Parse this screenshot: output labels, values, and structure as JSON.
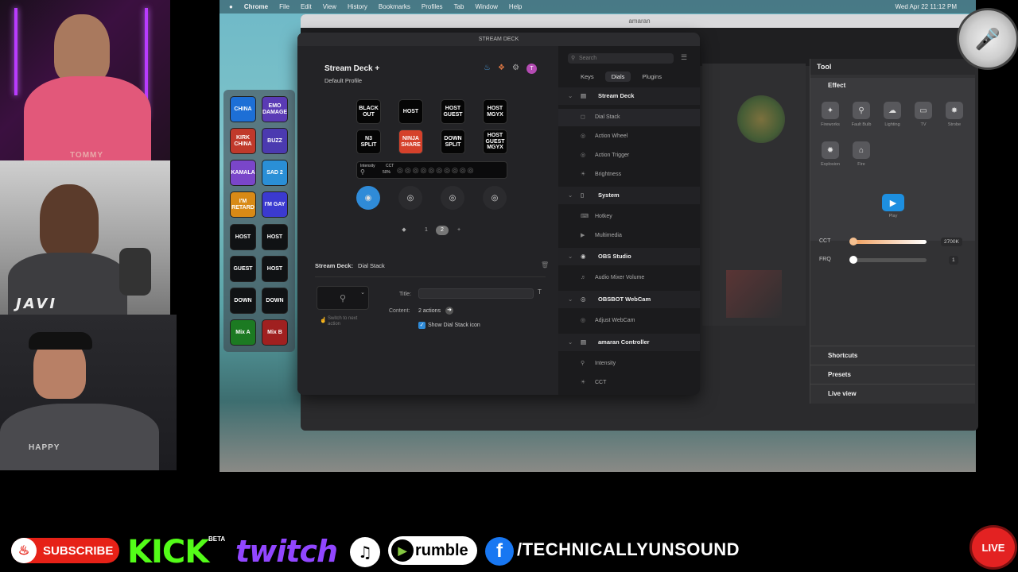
{
  "menubar": {
    "app": "Chrome",
    "items": [
      "File",
      "Edit",
      "View",
      "History",
      "Bookmarks",
      "Profiles",
      "Tab",
      "Window",
      "Help"
    ],
    "clock": "Wed Apr 22  11:12 PM"
  },
  "webcams": {
    "cam1_shirt": "TOMMY",
    "cam2_caption": "JAVI",
    "cam3_shirt": "HAPPY"
  },
  "amaran": {
    "window_title": "amaran",
    "tool_title": "Tool",
    "effect_title": "Effect",
    "effects": [
      "Fireworks",
      "Fault Bulb",
      "Lighting",
      "TV",
      "Strobe",
      "Explosion",
      "Fire"
    ],
    "play_label": "Play",
    "cct_label": "CCT",
    "cct_value": "2700K",
    "cct_level": 0.0,
    "frq_label": "FRQ",
    "frq_value": "1",
    "sections": [
      "Shortcuts",
      "Presets",
      "Live view"
    ]
  },
  "stream_deck": {
    "window_title": "STREAM DECK",
    "device": "Stream Deck +",
    "profile": "Default Profile",
    "avatar_letter": "T",
    "keys": [
      "BLACK OUT",
      "HOST",
      "HOST GUEST",
      "HOST MGYX",
      "N3 SPLIT",
      "NINJA SHARE",
      "DOWN SPLIT",
      "HOST GUEST MGYX"
    ],
    "strip_label": "Intensity",
    "strip_cct": "CCT",
    "strip_value": "50%",
    "pages": [
      "1",
      "2"
    ],
    "active_page": "2",
    "prop_header": "Stream Deck:",
    "prop_action": "Dial Stack",
    "title_label": "Title:",
    "content_label": "Content:",
    "content_value": "2 actions",
    "switch_label": "Switch to next action",
    "show_icon_label": "Show Dial Stack icon",
    "search_placeholder": "Search",
    "tabs": [
      "Keys",
      "Dials",
      "Plugins"
    ],
    "categories": [
      {
        "name": "Stream Deck",
        "actions": [
          "Dial Stack",
          "Action Wheel",
          "Action Trigger",
          "Brightness"
        ]
      },
      {
        "name": "System",
        "actions": [
          "Hotkey",
          "Multimedia"
        ]
      },
      {
        "name": "OBS Studio",
        "actions": [
          "Audio Mixer Volume"
        ]
      },
      {
        "name": "OBSBOT WebCam",
        "actions": [
          "Adjust WebCam"
        ]
      },
      {
        "name": "amaran Controller",
        "actions": [
          "Intensity",
          "CCT"
        ]
      }
    ]
  },
  "deck_keys": [
    {
      "label": "CHINA",
      "color": "#1d6fd6"
    },
    {
      "label": "EMO DAMAGE",
      "color": "#5a3bb5"
    },
    {
      "label": "KIRK CHINA",
      "color": "#c0392b"
    },
    {
      "label": "BUZZ",
      "color": "#4b3ab0"
    },
    {
      "label": "KAMALA",
      "color": "#7a46c9"
    },
    {
      "label": "SAD 2",
      "color": "#2a8fd6"
    },
    {
      "label": "I'M RETARD",
      "color": "#d88a16"
    },
    {
      "label": "I'M GAY",
      "color": "#3b3ad0"
    },
    {
      "label": "HOST",
      "color": "#101214"
    },
    {
      "label": "HOST",
      "color": "#101214"
    },
    {
      "label": "GUEST",
      "color": "#101214"
    },
    {
      "label": "HOST",
      "color": "#101214"
    },
    {
      "label": "DOWN",
      "color": "#101214"
    },
    {
      "label": "DOWN",
      "color": "#101214"
    },
    {
      "label": "Mix A",
      "color": "#1c7a22"
    },
    {
      "label": "Mix B",
      "color": "#a02020"
    }
  ],
  "bottom_bar": {
    "subscribe": "SUBSCRIBE",
    "kick": "KICK",
    "beta": "BETA",
    "twitch": "twitch",
    "rumble": "rumble",
    "handle": "/TECHNICALLYUNSOUND",
    "live": "LIVE"
  }
}
